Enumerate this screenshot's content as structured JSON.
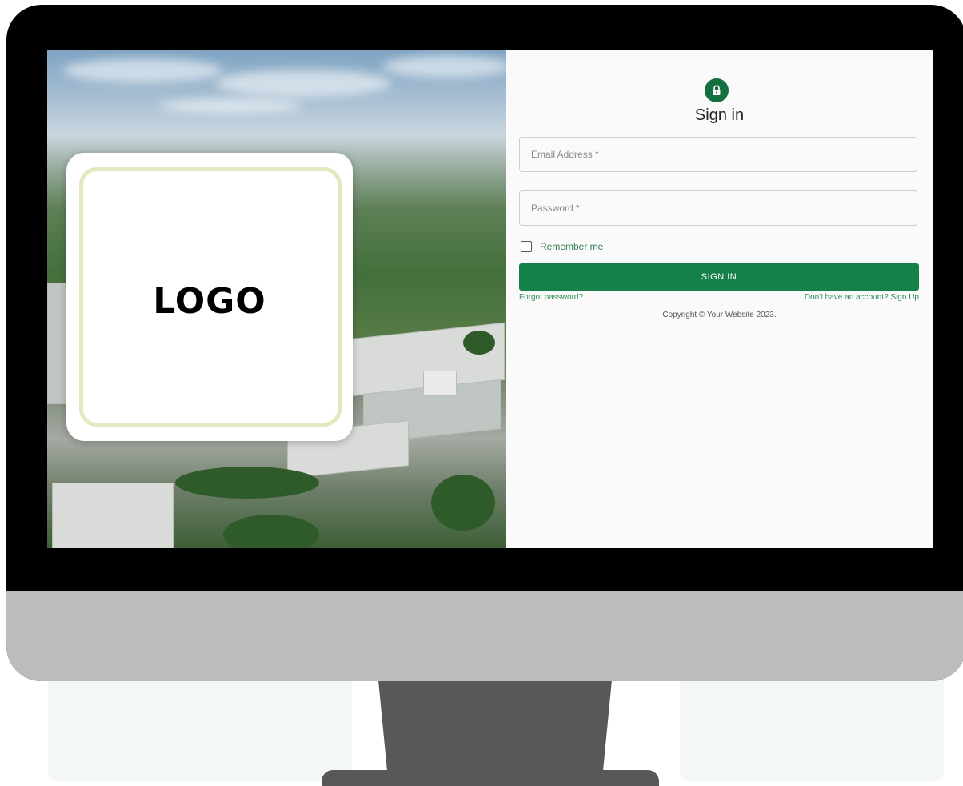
{
  "hero": {
    "logo_text": "LOGO"
  },
  "signin": {
    "heading": "Sign in",
    "email_placeholder": "Email Address *",
    "password_placeholder": "Password *",
    "remember_label": "Remember me",
    "submit_label": "SIGN IN",
    "forgot_link": "Forgot password?",
    "signup_link": "Don't have an account? Sign Up",
    "copyright": "Copyright © Your Website 2023."
  },
  "icons": {
    "avatar": "lock-icon"
  },
  "colors": {
    "accent": "#15804a",
    "link": "#2e8b57",
    "monitor_bezel": "#000000",
    "monitor_chin": "#bcbcbc",
    "stand": "#585858"
  }
}
